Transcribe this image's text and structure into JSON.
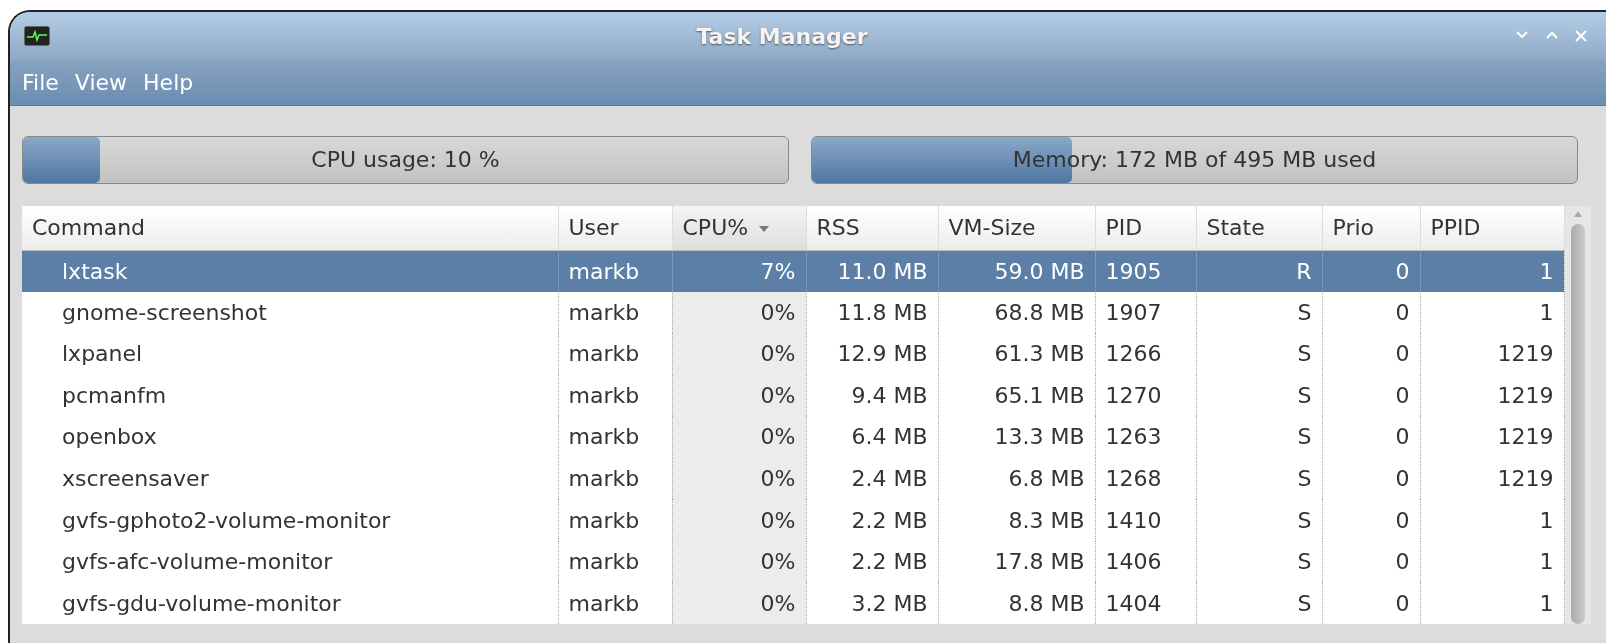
{
  "window": {
    "title": "Task Manager"
  },
  "menu": [
    "File",
    "View",
    "Help"
  ],
  "meters": [
    {
      "label": "CPU usage: 10 %",
      "level": 0.1
    },
    {
      "label": "Memory: 172 MB of 495 MB used",
      "level": 0.34
    }
  ],
  "table": {
    "columns": [
      {
        "label": "Command",
        "sorted": false
      },
      {
        "label": "User",
        "sorted": false
      },
      {
        "label": "CPU%",
        "sorted": true
      },
      {
        "label": "RSS",
        "sorted": false
      },
      {
        "label": "VM-Size",
        "sorted": false
      },
      {
        "label": "PID",
        "sorted": false
      },
      {
        "label": "State",
        "sorted": false
      },
      {
        "label": "Prio",
        "sorted": false
      },
      {
        "label": "PPID",
        "sorted": false
      }
    ],
    "rows": [
      {
        "selected": true,
        "cells": [
          "lxtask",
          "markb",
          "7%",
          "11.0 MB",
          "59.0 MB",
          "1905",
          "R",
          "0",
          "1"
        ]
      },
      {
        "selected": false,
        "cells": [
          "gnome-screenshot",
          "markb",
          "0%",
          "11.8 MB",
          "68.8 MB",
          "1907",
          "S",
          "0",
          "1"
        ]
      },
      {
        "selected": false,
        "cells": [
          "lxpanel",
          "markb",
          "0%",
          "12.9 MB",
          "61.3 MB",
          "1266",
          "S",
          "0",
          "1219"
        ]
      },
      {
        "selected": false,
        "cells": [
          "pcmanfm",
          "markb",
          "0%",
          "9.4 MB",
          "65.1 MB",
          "1270",
          "S",
          "0",
          "1219"
        ]
      },
      {
        "selected": false,
        "cells": [
          "openbox",
          "markb",
          "0%",
          "6.4 MB",
          "13.3 MB",
          "1263",
          "S",
          "0",
          "1219"
        ]
      },
      {
        "selected": false,
        "cells": [
          "xscreensaver",
          "markb",
          "0%",
          "2.4 MB",
          "6.8 MB",
          "1268",
          "S",
          "0",
          "1219"
        ]
      },
      {
        "selected": false,
        "cells": [
          "gvfs-gphoto2-volume-monitor",
          "markb",
          "0%",
          "2.2 MB",
          "8.3 MB",
          "1410",
          "S",
          "0",
          "1"
        ]
      },
      {
        "selected": false,
        "cells": [
          "gvfs-afc-volume-monitor",
          "markb",
          "0%",
          "2.2 MB",
          "17.8 MB",
          "1406",
          "S",
          "0",
          "1"
        ]
      },
      {
        "selected": false,
        "cells": [
          "gvfs-gdu-volume-monitor",
          "markb",
          "0%",
          "3.2 MB",
          "8.8 MB",
          "1404",
          "S",
          "0",
          "1"
        ]
      }
    ]
  }
}
